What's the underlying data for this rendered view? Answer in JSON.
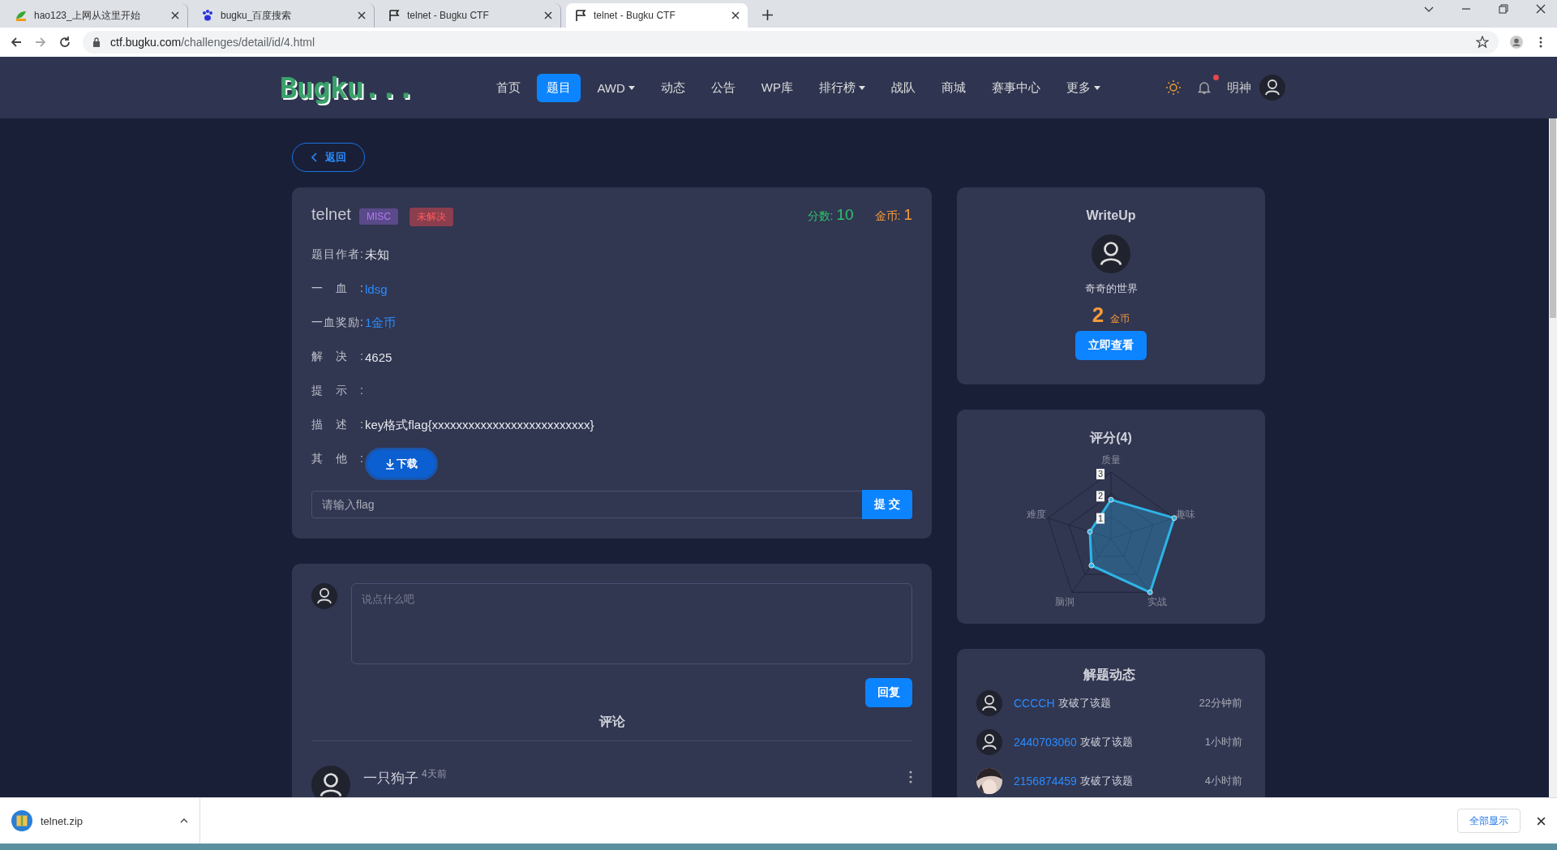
{
  "browser": {
    "tabs": [
      {
        "title": "hao123_上网从这里开始",
        "kind": "hao",
        "selected": false
      },
      {
        "title": "bugku_百度搜索",
        "kind": "paw",
        "selected": false
      },
      {
        "title": "telnet - Bugku CTF",
        "kind": "flag",
        "selected": false
      },
      {
        "title": "telnet - Bugku CTF",
        "kind": "flag",
        "selected": true
      }
    ],
    "host": "ctf.bugku.com",
    "path": "/challenges/detail/id/4.html"
  },
  "nav": {
    "logo": "Bugku...",
    "items": [
      {
        "label": "首页",
        "selected": false,
        "dropdown": false
      },
      {
        "label": "题目",
        "selected": true,
        "dropdown": false
      },
      {
        "label": "AWD",
        "selected": false,
        "dropdown": true
      },
      {
        "label": "动态",
        "selected": false,
        "dropdown": false
      },
      {
        "label": "公告",
        "selected": false,
        "dropdown": false
      },
      {
        "label": "WP库",
        "selected": false,
        "dropdown": false
      },
      {
        "label": "排行榜",
        "selected": false,
        "dropdown": true
      },
      {
        "label": "战队",
        "selected": false,
        "dropdown": false
      },
      {
        "label": "商城",
        "selected": false,
        "dropdown": false
      },
      {
        "label": "赛事中心",
        "selected": false,
        "dropdown": false
      },
      {
        "label": "更多",
        "selected": false,
        "dropdown": true
      }
    ],
    "notification": true,
    "username": "明神"
  },
  "back_button": "返回",
  "challenge": {
    "title": "telnet",
    "category": "MISC",
    "status": "未解决",
    "score_label": "分数:",
    "score": "10",
    "coins_label": "金币:",
    "coins": "1",
    "fields": [
      {
        "label": "题目作者:",
        "kind": "text",
        "value": "未知"
      },
      {
        "label": "一血:",
        "kind": "link",
        "value": "ldsg"
      },
      {
        "label": "一血奖励:",
        "kind": "link",
        "value": "1金币"
      },
      {
        "label": "解决:",
        "kind": "text",
        "value": "4625"
      },
      {
        "label": "提示:",
        "kind": "empty"
      },
      {
        "label": "描述:",
        "kind": "text",
        "value": "key格式flag{xxxxxxxxxxxxxxxxxxxxxxxxxx}"
      },
      {
        "label": "其他:",
        "kind": "download",
        "value": "下载"
      }
    ],
    "flag_input": {
      "placeholder": "请输入flag",
      "submit": "提 交"
    }
  },
  "comment_box": {
    "placeholder": "说点什么吧",
    "reply_button": "回复",
    "heading": "评论",
    "comments": [
      {
        "author": "一只狗子",
        "time": "4天前"
      }
    ]
  },
  "writeup": {
    "title": "WriteUp",
    "author": "奇奇的世界",
    "price": "2",
    "unit": "金币",
    "button": "立即查看"
  },
  "rating": {
    "title": "评分(4)",
    "chart_data": {
      "type": "radar",
      "categories": [
        "质量",
        "趣味",
        "实战",
        "脑洞",
        "难度"
      ],
      "values": [
        1.75,
        3,
        3,
        1.5,
        1
      ],
      "ylim": [
        0,
        3
      ],
      "yticks": [
        1,
        2,
        3
      ]
    }
  },
  "solves": {
    "title": "解题动态",
    "items": [
      {
        "user": "CCCCH",
        "action": "攻破了该题",
        "time": "22分钟前",
        "kind": "default"
      },
      {
        "user": "2440703060",
        "action": "攻破了该题",
        "time": "1小时前",
        "kind": "default"
      },
      {
        "user": "2156874459",
        "action": "攻破了该题",
        "time": "4小时前",
        "kind": "picture"
      }
    ]
  },
  "download_bar": {
    "file": "telnet.zip",
    "show_all": "全部显示"
  }
}
